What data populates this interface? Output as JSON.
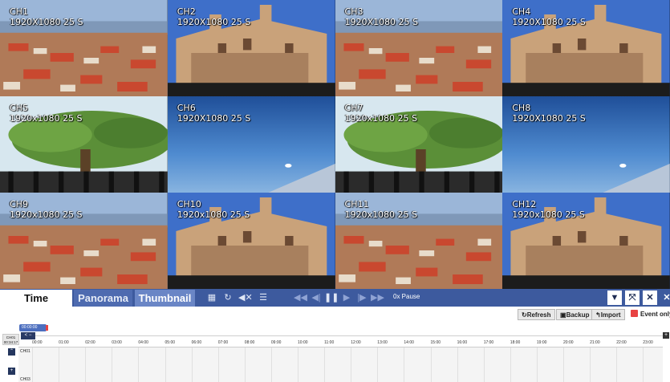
{
  "cameras": [
    {
      "name": "CH1",
      "res": "1920X1080 25 S",
      "scene": "city"
    },
    {
      "name": "CH2",
      "res": "1920X1080 25 S",
      "scene": "church"
    },
    {
      "name": "CH3",
      "res": "1920X1080 25 S",
      "scene": "city"
    },
    {
      "name": "CH4",
      "res": "1920X1080 25 S",
      "scene": "church"
    },
    {
      "name": "CH5",
      "res": "1920x1080 25 S",
      "scene": "tree"
    },
    {
      "name": "CH6",
      "res": "1920X1080 25 S",
      "scene": "sky"
    },
    {
      "name": "CH7",
      "res": "1920x1080 25 S",
      "scene": "tree"
    },
    {
      "name": "CH8",
      "res": "1920X1080 25 S",
      "scene": "sky"
    },
    {
      "name": "CH9",
      "res": "1920x1080 25 S",
      "scene": "city"
    },
    {
      "name": "CH10",
      "res": "1920x1080 25 S",
      "scene": "church"
    },
    {
      "name": "CH11",
      "res": "1920x1080 25 S",
      "scene": "city"
    },
    {
      "name": "CH12",
      "res": "1920x1080 25 S",
      "scene": "church"
    }
  ],
  "tabs": {
    "time": "Time",
    "panorama": "Panorama",
    "thumbnail": "Thumbnail"
  },
  "playback": {
    "speed": "0x Pause"
  },
  "actions": {
    "refresh": "Refresh",
    "backup": "Backup",
    "import": "Import",
    "event_only": "Event only"
  },
  "timeline": {
    "current_time": "00:00:00",
    "channel": "CH01",
    "channel_time": "00:34:17",
    "rows": [
      "CH01",
      "CH03"
    ],
    "hours": [
      "00:00",
      "01:00",
      "02:00",
      "03:00",
      "04:00",
      "05:00",
      "06:00",
      "07:00",
      "08:00",
      "09:00",
      "10:00",
      "11:00",
      "12:00",
      "13:00",
      "14:00",
      "15:00",
      "16:00",
      "17:00",
      "18:00",
      "19:00",
      "20:00",
      "21:00",
      "22:00",
      "23:00"
    ]
  },
  "colors": {
    "toolbar": "#3d5a9e",
    "event": "#e84343"
  }
}
